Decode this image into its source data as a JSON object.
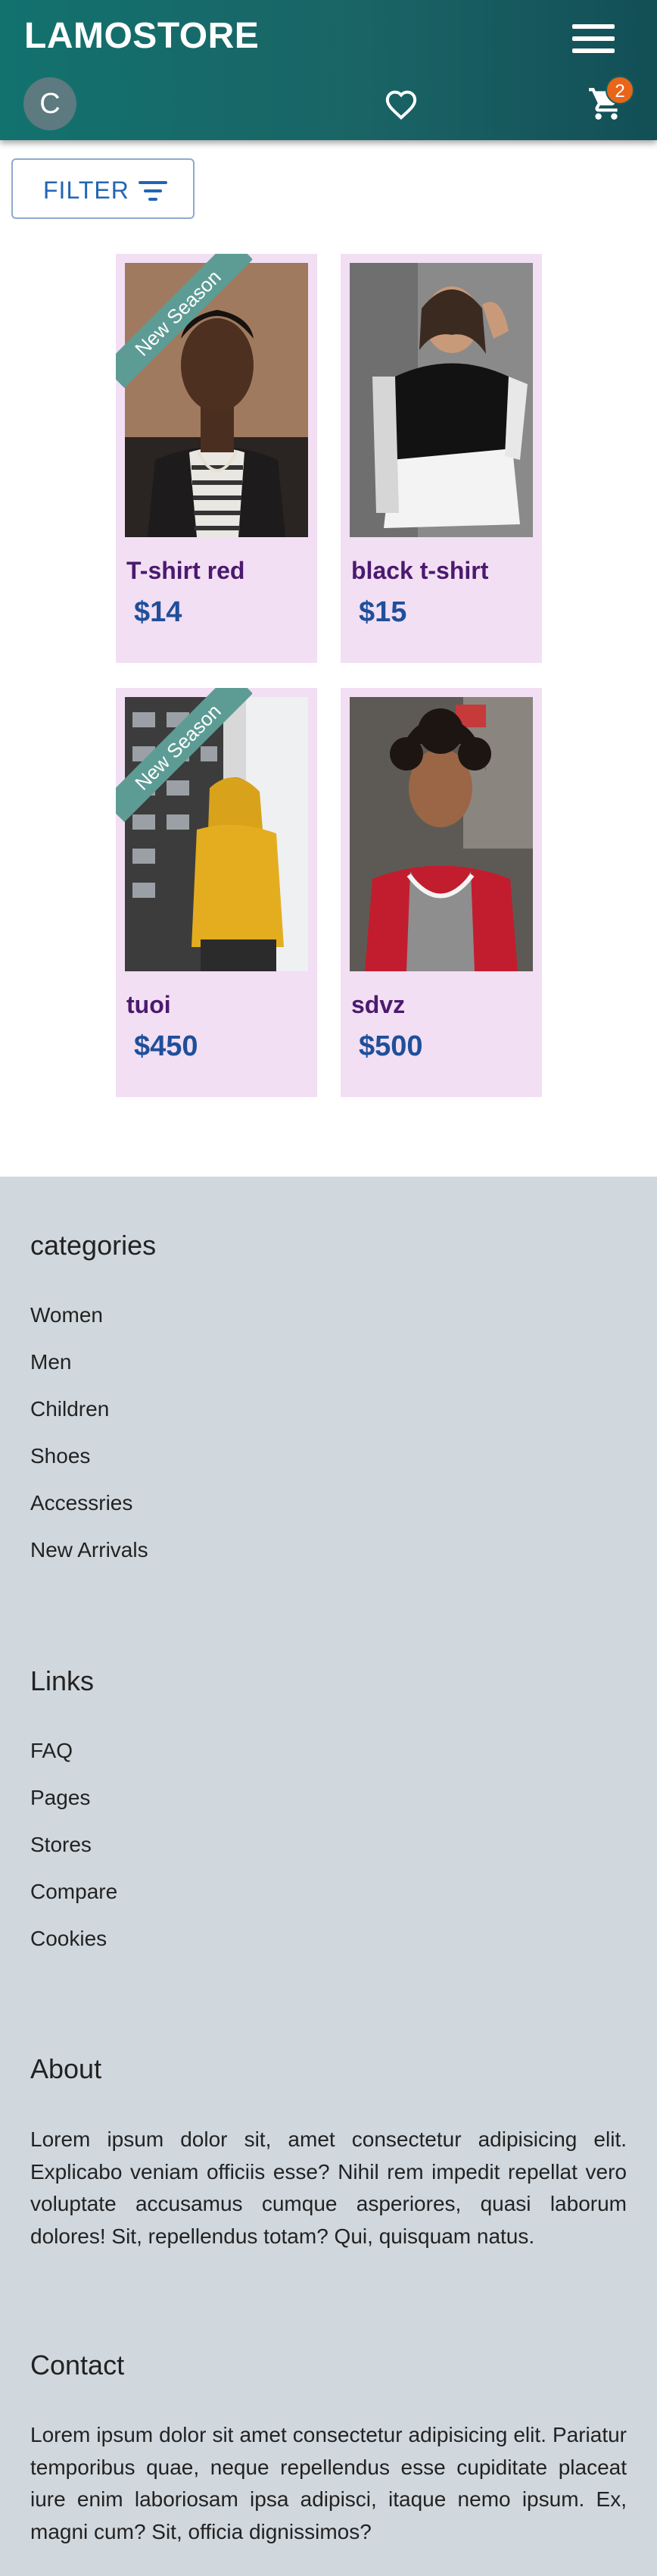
{
  "header": {
    "brand": "LAMOSTORE",
    "avatar_initial": "C",
    "cart_count": "2",
    "icons": {
      "menu": "hamburger-icon",
      "wishlist": "heart-icon",
      "cart": "cart-icon"
    },
    "colors": {
      "bar": "#1a6466",
      "badge": "#e8651a"
    }
  },
  "filter": {
    "label": "FILTER",
    "icon": "filter-icon"
  },
  "products": [
    {
      "name": "T-shirt red",
      "price": "$14",
      "ribbon": "New Season"
    },
    {
      "name": "black t-shirt",
      "price": "$15",
      "ribbon": ""
    },
    {
      "name": "tuoi",
      "price": "$450",
      "ribbon": "New Season"
    },
    {
      "name": "sdvz",
      "price": "$500",
      "ribbon": ""
    }
  ],
  "footer": {
    "categories": {
      "heading": "categories",
      "items": [
        "Women",
        "Men",
        "Children",
        "Shoes",
        "Accessries",
        "New Arrivals"
      ]
    },
    "links": {
      "heading": "Links",
      "items": [
        "FAQ",
        "Pages",
        "Stores",
        "Compare",
        "Cookies"
      ]
    },
    "about": {
      "heading": "About",
      "text": "Lorem ipsum dolor sit, amet consectetur adipisicing elit. Explicabo veniam officiis esse? Nihil rem impedit repellat vero voluptate accusamus cumque asperiores, quasi laborum dolores! Sit, repellendus totam? Qui, quisquam natus."
    },
    "contact": {
      "heading": "Contact",
      "text": "Lorem ipsum dolor sit amet consectetur adipisicing elit. Pariatur temporibus quae, neque repellendus esse cupiditate placeat iure enim laboriosam ipsa adipisci, itaque nemo ipsum. Ex, magni cum? Sit, officia dignissimos?"
    }
  }
}
